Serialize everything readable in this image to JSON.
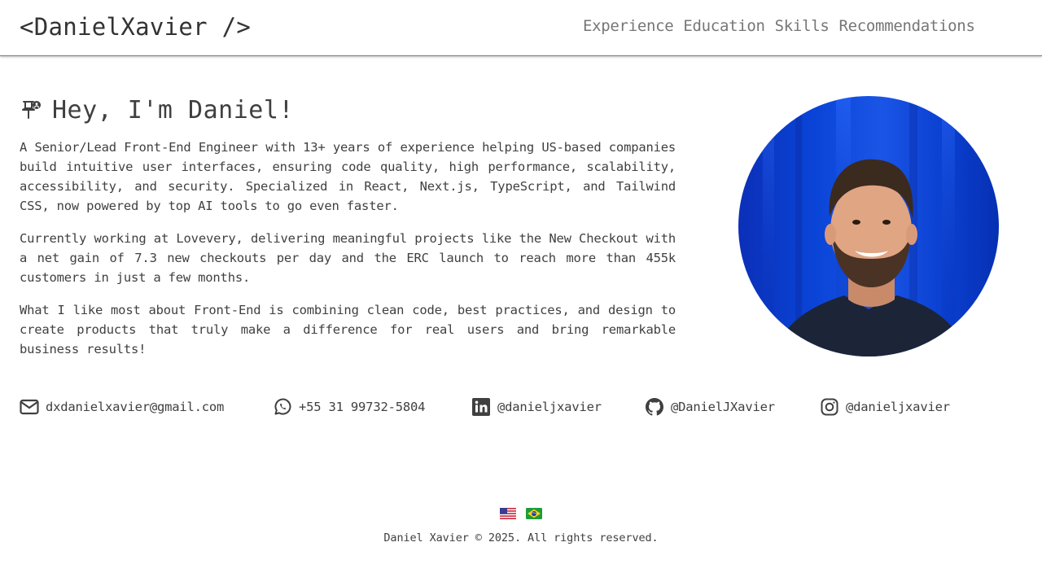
{
  "header": {
    "logo": "<DanielXavier />",
    "nav": [
      "Experience",
      "Education",
      "Skills",
      "Recommendations"
    ]
  },
  "intro": {
    "icon": "pushpin-icon",
    "headline": "Hey, I'm Daniel!",
    "paragraphs": [
      "A Senior/Lead Front-End Engineer with 13+ years of experience helping US-based companies build intuitive user interfaces, ensuring code quality, high performance, scalability, accessibility, and security. Specialized in React, Next.js, TypeScript, and Tailwind CSS, now powered by top AI tools to go even faster.",
      "Currently working at Lovevery, delivering meaningful projects like the New Checkout with a net gain of 7.3 new checkouts per day and the ERC launch to reach more than 455k customers in just a few months.",
      "What I like most about Front-End is combining clean code, best practices, and design to create products that truly make a difference for real users and bring remarkable business results!"
    ]
  },
  "contacts": [
    {
      "icon": "envelope-icon",
      "text": "dxdanielxavier@gmail.com"
    },
    {
      "icon": "whatsapp-icon",
      "text": "+55 31 99732-5804"
    },
    {
      "icon": "linkedin-icon",
      "text": "@danieljxavier"
    },
    {
      "icon": "github-icon",
      "text": "@DanielJXavier"
    },
    {
      "icon": "instagram-icon",
      "text": "@danieljxavier"
    }
  ],
  "languages": [
    {
      "icon": "us-flag-icon"
    },
    {
      "icon": "brazil-flag-icon"
    }
  ],
  "footer": {
    "copyright": "Daniel Xavier © 2025. All rights reserved."
  },
  "colors": {
    "text": "#404040",
    "nav": "#767676",
    "photo_background": "#0a3fd0"
  }
}
